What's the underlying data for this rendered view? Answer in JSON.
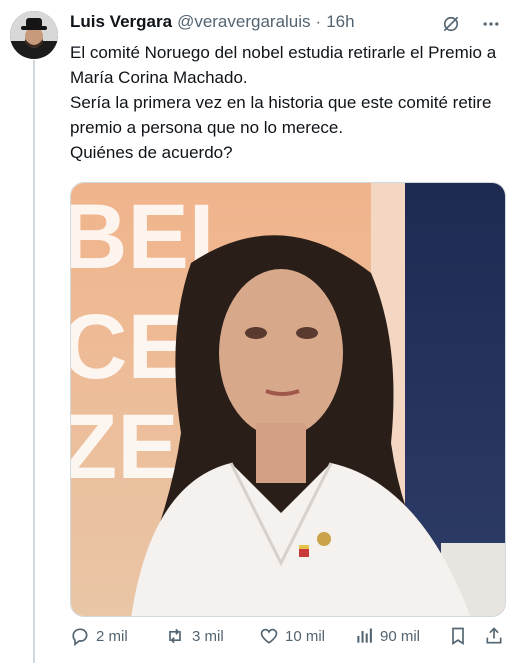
{
  "tweet": {
    "author_name": "Luis Vergara",
    "handle": "@veravergaraluis",
    "separator": "·",
    "time": "16h",
    "text_line1": "El comité Noruego del nobel estudia retirarle el Premio a María Corina Machado.",
    "text_line2": "Sería la primera vez en la historia que este comité retire premio a persona que no lo merece.",
    "text_line3": "Quiénes de acuerdo?",
    "image_backdrop_text": [
      "BEL",
      "CE",
      "ZE"
    ]
  },
  "actions": {
    "replies": "2 mil",
    "reposts": "3 mil",
    "likes": "10 mil",
    "views": "90 mil"
  },
  "icons": {
    "header": [
      "grok-icon",
      "more-options-icon"
    ],
    "actions": [
      "reply-icon",
      "repost-icon",
      "like-icon",
      "views-icon",
      "bookmark-icon",
      "share-icon"
    ]
  },
  "colors": {
    "text_primary": "#0f1419",
    "text_secondary": "#536471",
    "border": "#cfd9de"
  }
}
